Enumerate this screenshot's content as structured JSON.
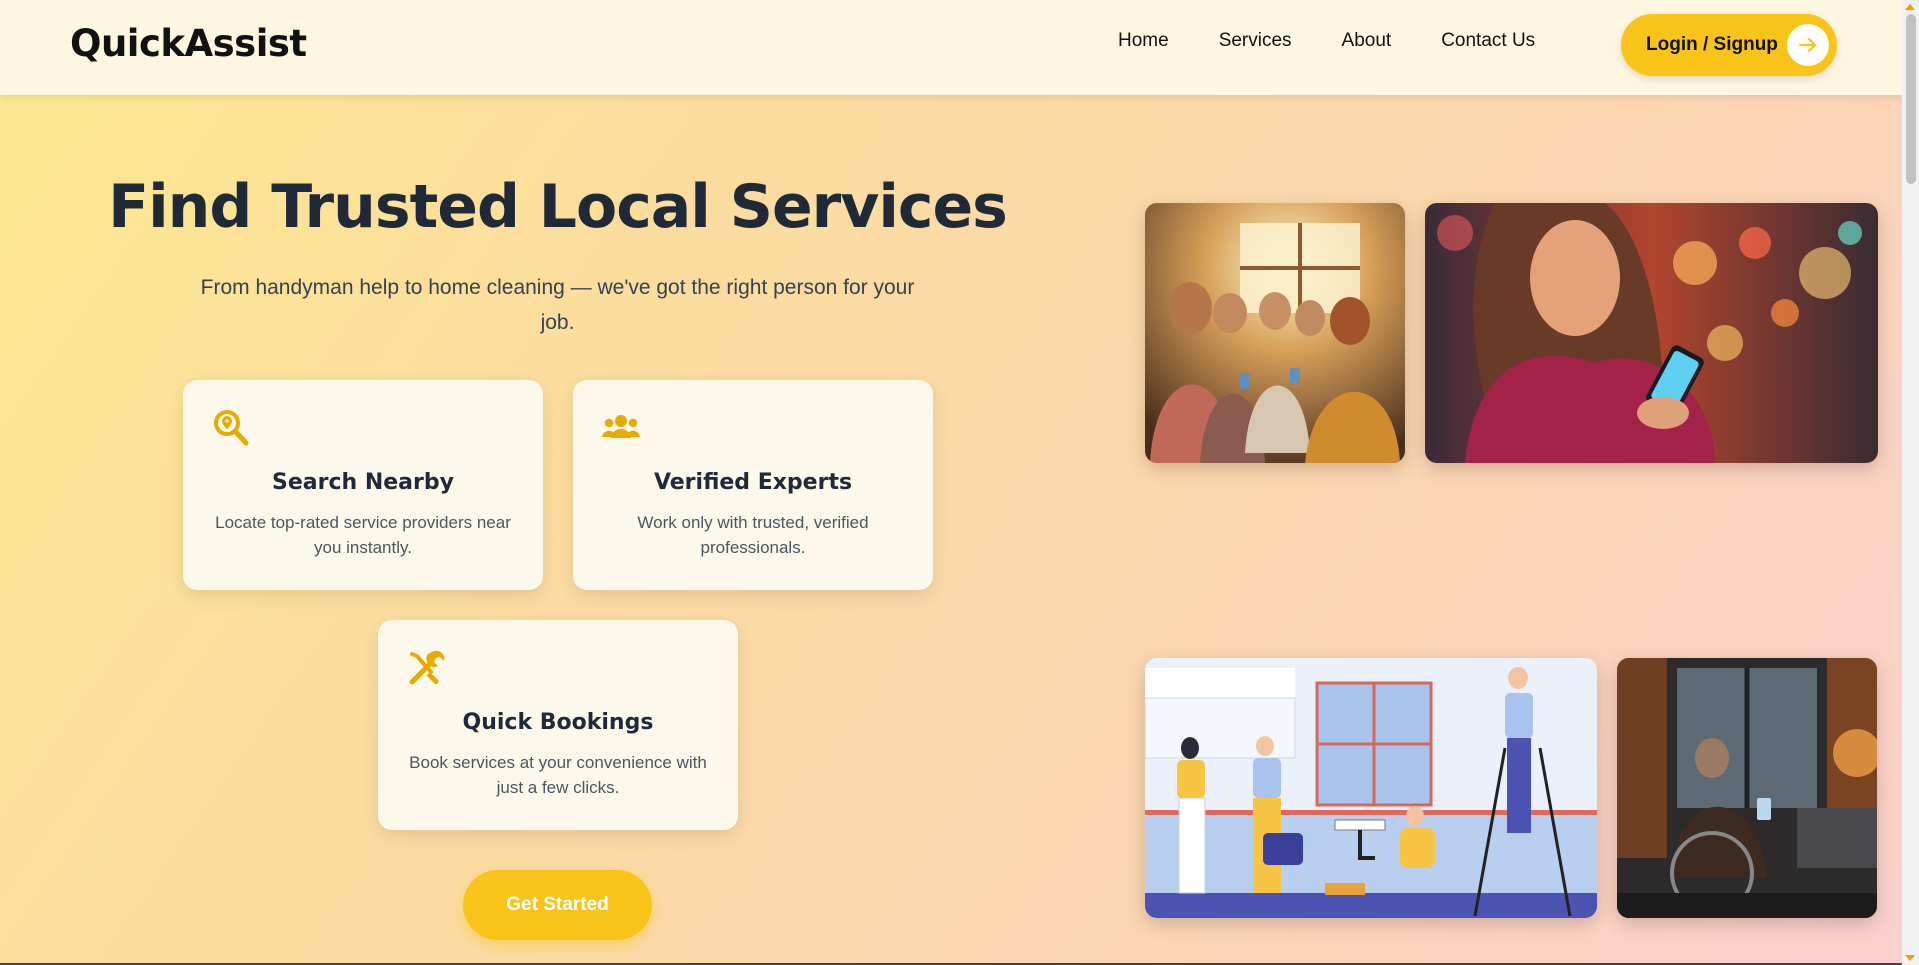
{
  "header": {
    "logo": "QuickAssist",
    "nav": [
      "Home",
      "Services",
      "About",
      "Contact Us"
    ],
    "login_label": "Login / Signup"
  },
  "hero": {
    "title": "Find Trusted Local Services",
    "subtitle": "From handyman help to home cleaning — we've got the right person for your job.",
    "cta_label": "Get Started"
  },
  "features": [
    {
      "icon": "search-location-icon",
      "title": "Search Nearby",
      "description": "Locate top-rated service providers near you instantly."
    },
    {
      "icon": "users-icon",
      "title": "Verified Experts",
      "description": "Work only with trusted, verified professionals."
    },
    {
      "icon": "tools-icon",
      "title": "Quick Bookings",
      "description": "Book services at your convenience with just a few clicks."
    }
  ],
  "colors": {
    "accent": "#f9c41a",
    "text_dark": "#1f2937",
    "card_bg": "#fdf8ec"
  }
}
